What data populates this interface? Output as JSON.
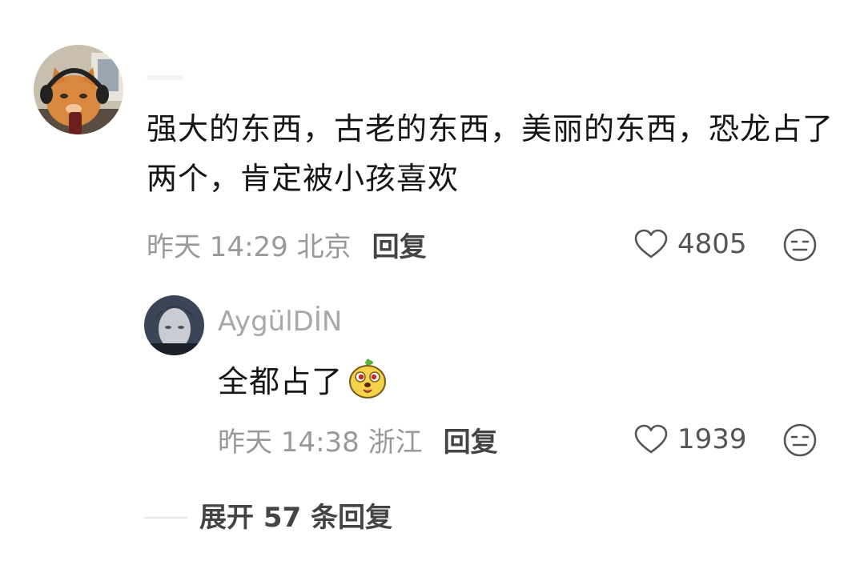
{
  "main_comment": {
    "avatar_icon": "cat-avatar-icon",
    "text": "强大的东西，古老的东西，美丽的东西，恐龙占了两个，肯定被小孩喜欢",
    "meta": "昨天 14:29 北京",
    "reply_label": "回复",
    "like_count": "4805",
    "like_icon": "heart-icon",
    "dislike_icon": "meh-face-icon"
  },
  "reply_comment": {
    "avatar_icon": "portrait-avatar-icon",
    "username": "AygülDİN",
    "text": "全都占了",
    "emoji_icon": "dog-face-emoji-icon",
    "meta": "昨天 14:38 浙江",
    "reply_label": "回复",
    "like_count": "1939",
    "like_icon": "heart-icon",
    "dislike_icon": "meh-face-icon"
  },
  "expand": {
    "label": "展开 57 条回复"
  }
}
